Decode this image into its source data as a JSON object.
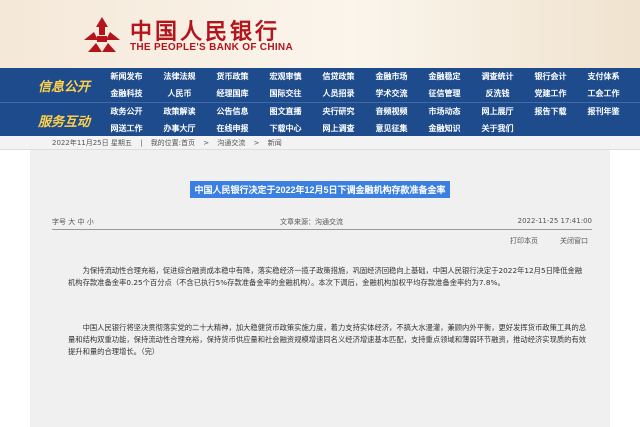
{
  "header": {
    "logo_cn": "中国人民银行",
    "logo_en": "THE PEOPLE'S BANK OF CHINA",
    "brand_color": "#b4151c"
  },
  "nav": {
    "sections": [
      {
        "label": "信息公开",
        "rows": [
          [
            "新闻发布",
            "法律法规",
            "货币政策",
            "宏观审慎",
            "信贷政策",
            "金融市场",
            "金融稳定",
            "调查统计",
            "银行会计",
            "支付体系"
          ],
          [
            "金融科技",
            "人民币",
            "经理国库",
            "国际交往",
            "人员招录",
            "学术交流",
            "征信管理",
            "反洗钱",
            "党建工作",
            "工会工作"
          ]
        ]
      },
      {
        "label": "服务互动",
        "rows": [
          [
            "政务公开",
            "政策解读",
            "公告信息",
            "图文直播",
            "央行研究",
            "音频视频",
            "市场动态",
            "网上展厅",
            "报告下载",
            "报刊年鉴"
          ],
          [
            "网送工作",
            "办事大厅",
            "在线申报",
            "下载中心",
            "网上调查",
            "意见征集",
            "金融知识",
            "关于我们",
            "",
            ""
          ]
        ]
      }
    ],
    "bg_color": "#1d4b8c",
    "label_color": "#ffd04a"
  },
  "breadcrumb": {
    "date": "2022年11月25日 星期五",
    "prefix": "我的位置:",
    "items": [
      "首页",
      "沟通交流",
      "新闻"
    ],
    "separator": ">"
  },
  "article": {
    "title": "中国人民银行决定于2022年12月5日下调金融机构存款准备金率",
    "font_size_label": "字号",
    "font_sizes": [
      "大",
      "中",
      "小"
    ],
    "source": "文章来源：沟通交流",
    "datetime": "2022-11-25  17:41:00",
    "print_label": "打印本页",
    "close_label": "关闭窗口",
    "paragraphs": [
      "为保持流动性合理充裕，促进综合融资成本稳中有降，落实稳经济一揽子政策措施，巩固经济回稳向上基础，中国人民银行决定于2022年12月5日降低金融机构存款准备金率0.25个百分点（不含已执行5%存款准备金率的金融机构）。本次下调后，金融机构加权平均存款准备金率约为7.8%。",
      "中国人民银行将坚决贯彻落实党的二十大精神，加大稳健货币政策实施力度，着力支持实体经济，不搞大水漫灌，兼顾内外平衡，更好发挥货币政策工具的总量和结构双重功能，保持流动性合理充裕，保持货币供应量和社会融资规模增速同名义经济增速基本匹配，支持重点领域和薄弱环节融资，推动经济实现质的有效提升和量的合理增长。（完）"
    ],
    "title_highlight_color": "#3b7fe0"
  }
}
